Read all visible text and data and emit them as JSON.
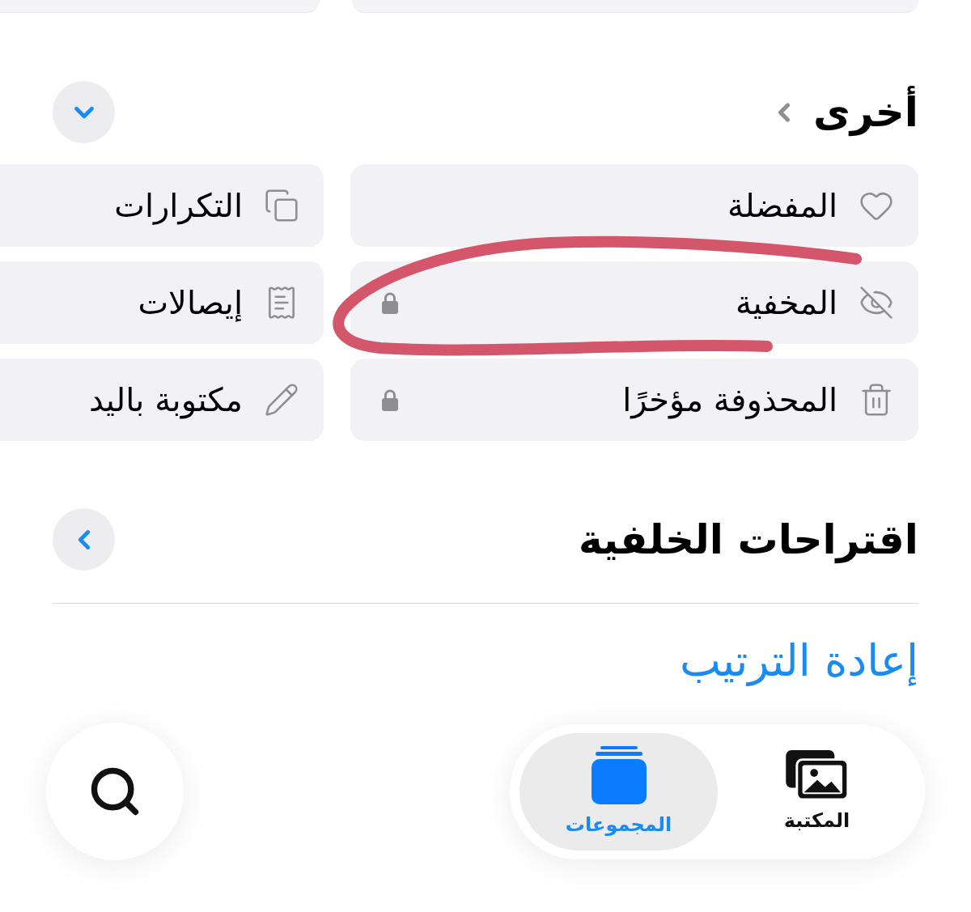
{
  "sections": [
    {
      "title": "أخرى",
      "title_chevron": true,
      "button": {
        "kind": "expand"
      },
      "tiles": [
        {
          "label": "المفضلة",
          "locked": false
        },
        {
          "label": "التكرارات",
          "locked": false
        },
        {
          "label": "المخفية",
          "locked": true
        },
        {
          "label": "إيصالات",
          "locked": false
        },
        {
          "label": "المحذوفة مؤخرًا",
          "locked": true
        },
        {
          "label": "مكتوبة باليد",
          "locked": false
        }
      ]
    },
    {
      "title": "اقتراحات الخلفية",
      "title_chevron": false,
      "button": {
        "kind": "navigate"
      }
    }
  ],
  "link": {
    "label": "إعادة الترتيب"
  },
  "tab_bar": {
    "tabs": [
      {
        "label": "المكتبة",
        "selected": false
      },
      {
        "label": "المجموعات",
        "selected": true
      }
    ]
  }
}
